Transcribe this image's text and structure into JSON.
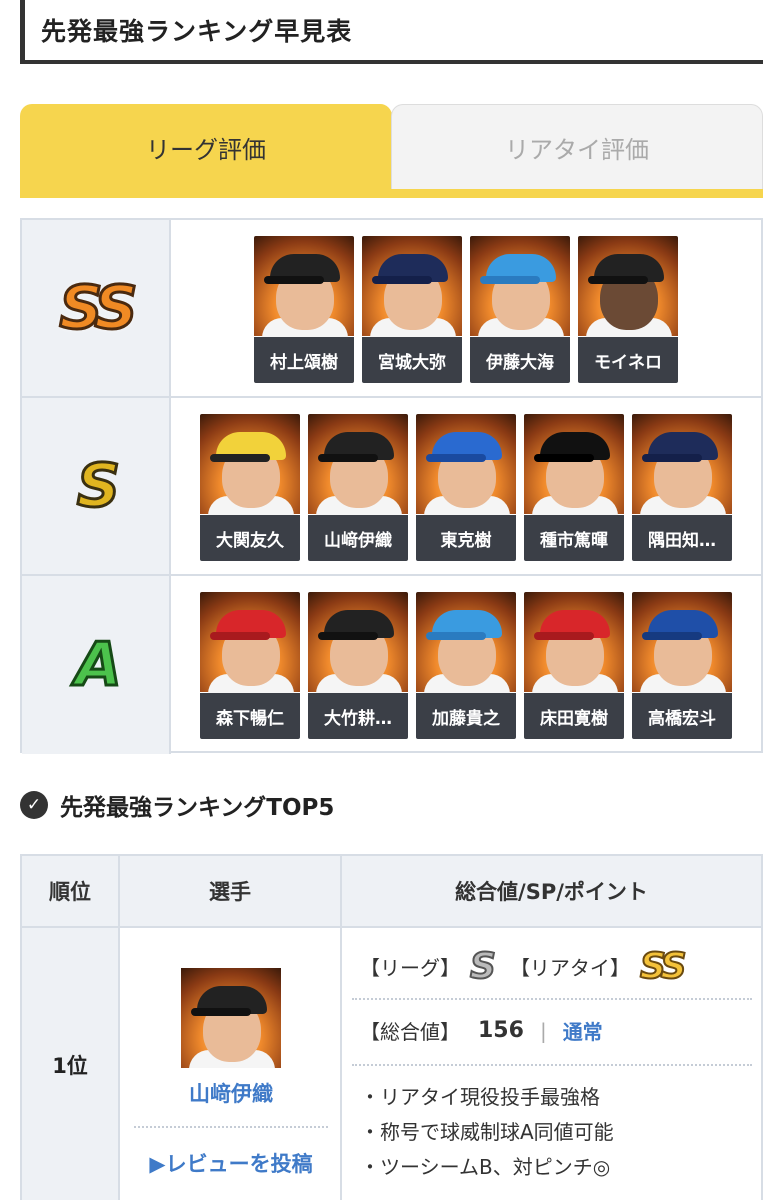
{
  "header": {
    "title": "先発最強ランキング早見表"
  },
  "tabs": [
    {
      "label": "リーグ評価",
      "active": true
    },
    {
      "label": "リアタイ評価",
      "active": false
    }
  ],
  "tiers": [
    {
      "rank": "SS",
      "players": [
        "村上頌樹",
        "宮城大弥",
        "伊藤大海",
        "モイネロ"
      ]
    },
    {
      "rank": "S",
      "players": [
        "大関友久",
        "山﨑伊織",
        "東克樹",
        "種市篤暉",
        "隅田知…"
      ]
    },
    {
      "rank": "A",
      "players": [
        "森下暢仁",
        "大竹耕…",
        "加藤貴之",
        "床田寛樹",
        "高橋宏斗"
      ]
    }
  ],
  "section": {
    "title": "先発最強ランキングTOP5"
  },
  "ranking_table": {
    "headers": {
      "rank": "順位",
      "player": "選手",
      "detail": "総合値/SP/ポイント"
    },
    "rows": [
      {
        "rank": "1位",
        "player_name": "山﨑伊織",
        "review_link": "▶レビューを投稿",
        "league_label": "【リーグ】",
        "league_rank": "S",
        "realtime_label": "【リアタイ】",
        "realtime_rank": "SS",
        "total_label": "【総合値】",
        "total_value": "156",
        "separator": "|",
        "type_link": "通常",
        "points": [
          "・リアタイ現役投手最強格",
          "・称号で球威制球A同値可能",
          "・ツーシームB、対ピンチ◎"
        ]
      }
    ]
  },
  "colors": {
    "accent": "#f6d54e",
    "link": "#3f7ac8",
    "name_bg": "#3b3f47"
  }
}
